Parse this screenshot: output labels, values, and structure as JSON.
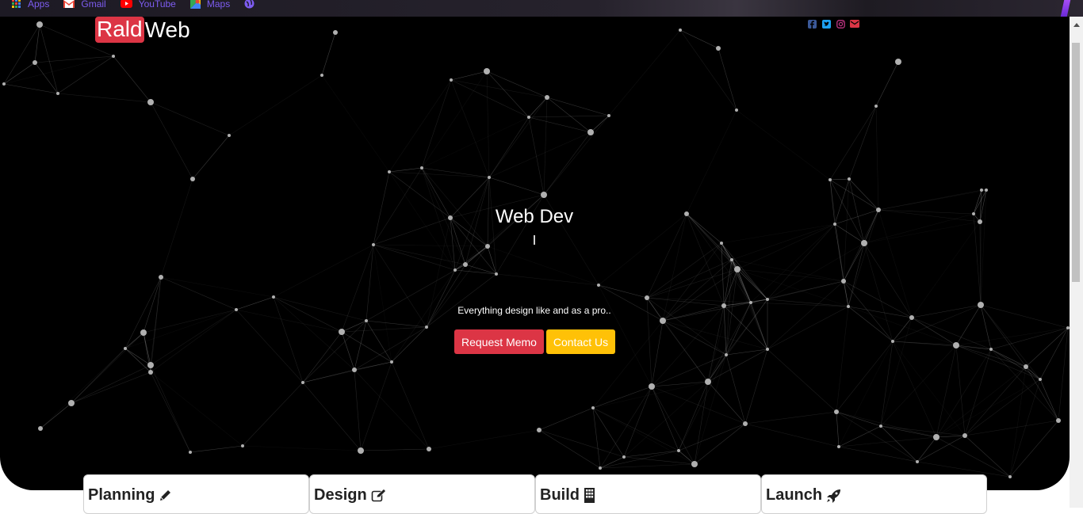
{
  "bookmarks": [
    {
      "label": "Apps",
      "icon": "apps-grid-icon"
    },
    {
      "label": "Gmail",
      "icon": "gmail-icon"
    },
    {
      "label": "YouTube",
      "icon": "youtube-icon"
    },
    {
      "label": "Maps",
      "icon": "maps-icon"
    },
    {
      "label": "",
      "icon": "globe-icon"
    }
  ],
  "brand": {
    "part1": "Rald",
    "part2": "Web",
    "accent": "#dc3545"
  },
  "social": [
    {
      "name": "facebook",
      "icon": "facebook-icon",
      "color": "#3b5998"
    },
    {
      "name": "twitter",
      "icon": "twitter-icon",
      "color": "#1da1f2"
    },
    {
      "name": "instagram",
      "icon": "instagram-icon",
      "color": "#c13584"
    },
    {
      "name": "email",
      "icon": "envelope-icon",
      "color": "#dc3545"
    }
  ],
  "hero": {
    "title": "Web Dev",
    "tagline": "Everything design like and as a pro..",
    "buttons": [
      {
        "label": "Request Memo",
        "color": "#dc3545"
      },
      {
        "label": "Contact Us",
        "color": "#ffc107"
      }
    ]
  },
  "cards": [
    {
      "title": "Planning",
      "icon": "pencil-icon"
    },
    {
      "title": "Design",
      "icon": "edit-icon"
    },
    {
      "title": "Build",
      "icon": "building-icon"
    },
    {
      "title": "Launch",
      "icon": "rocket-icon"
    }
  ]
}
